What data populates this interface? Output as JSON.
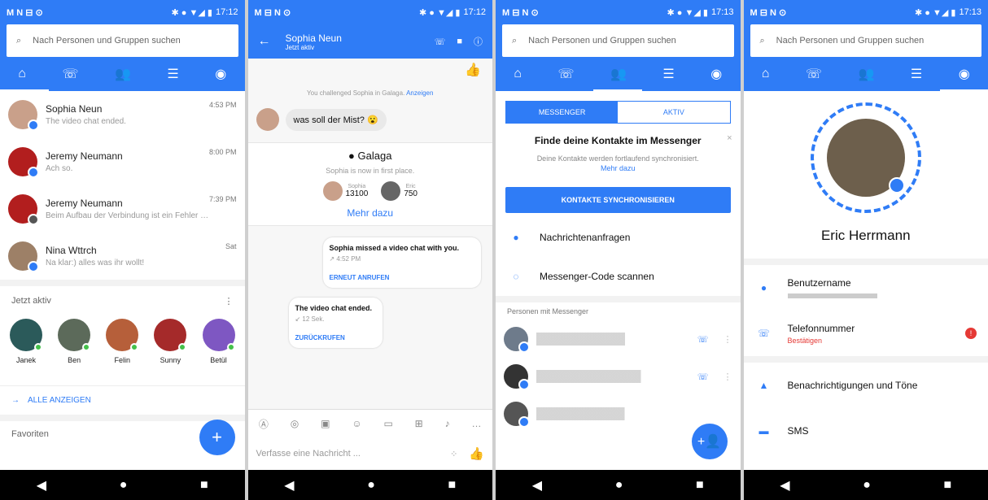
{
  "phones": {
    "p1": {
      "status": {
        "left": "M N ⊟ ⊙",
        "time": "17:12"
      },
      "search_placeholder": "Nach Personen und Gruppen suchen",
      "tabs": [
        "home",
        "call",
        "people",
        "list",
        "profile"
      ],
      "chats": [
        {
          "name": "Sophia Neun",
          "snippet": "The video chat ended.",
          "time": "4:53 PM"
        },
        {
          "name": "Jeremy Neumann",
          "snippet": "Ach so.",
          "time": "8:00 PM"
        },
        {
          "name": "Jeremy Neumann",
          "snippet": "Beim Aufbau der Verbindung ist ein Fehler aufge...",
          "time": "7:39 PM"
        },
        {
          "name": "Nina Wttrch",
          "snippet": "Na klar:) alles was ihr wollt!",
          "time": "Sat"
        }
      ],
      "active_label": "Jetzt aktiv",
      "active_people": [
        "Janek",
        "Ben",
        "Felin",
        "Sunny",
        "Betül"
      ],
      "show_all": "ALLE ANZEIGEN",
      "favorites": "Favoriten",
      "fab_icon": "+"
    },
    "p2": {
      "status": {
        "left": "M ⊟ N ⊙",
        "time": "17:12"
      },
      "contact": "Sophia Neun",
      "contact_status": "Jetzt aktiv",
      "challenge": "You challenged Sophia in Galaga.",
      "view": "Anzeigen",
      "message": "was soll der Mist? 😮",
      "game": "Galaga",
      "game_status": "Sophia is now in first place.",
      "score1_name": "Sophia",
      "score1": "13100",
      "score2_name": "Eric",
      "score2": "750",
      "more": "Mehr dazu",
      "missed": "Sophia missed a video chat with you.",
      "missed_time": "↗ 4:52 PM",
      "call_again": "ERNEUT ANRUFEN",
      "ended": "The video chat ended.",
      "ended_time": "↙ 12 Sek.",
      "call_back": "ZURÜCKRUFEN",
      "compose": "Verfasse eine Nachricht ..."
    },
    "p3": {
      "status": {
        "left": "M ⊟ N ⊙",
        "time": "17:13"
      },
      "search_placeholder": "Nach Personen und Gruppen suchen",
      "tab1": "MESSENGER",
      "tab2": "AKTIV",
      "title": "Finde deine Kontakte im Messenger",
      "desc": "Deine Kontakte werden fortlaufend synchronisiert.",
      "more": "Mehr dazu",
      "sync": "KONTAKTE SYNCHRONISIEREN",
      "requests": "Nachrichtenanfragen",
      "scan": "Messenger-Code scannen",
      "people_label": "Personen mit Messenger"
    },
    "p4": {
      "status": {
        "left": "M ⊟ N ⊙",
        "time": "17:13"
      },
      "search_placeholder": "Nach Personen und Gruppen suchen",
      "name": "Eric Herrmann",
      "username_label": "Benutzername",
      "phone_label": "Telefonnummer",
      "confirm": "Bestätigen",
      "notifications": "Benachrichtigungen und Töne",
      "sms": "SMS"
    }
  }
}
